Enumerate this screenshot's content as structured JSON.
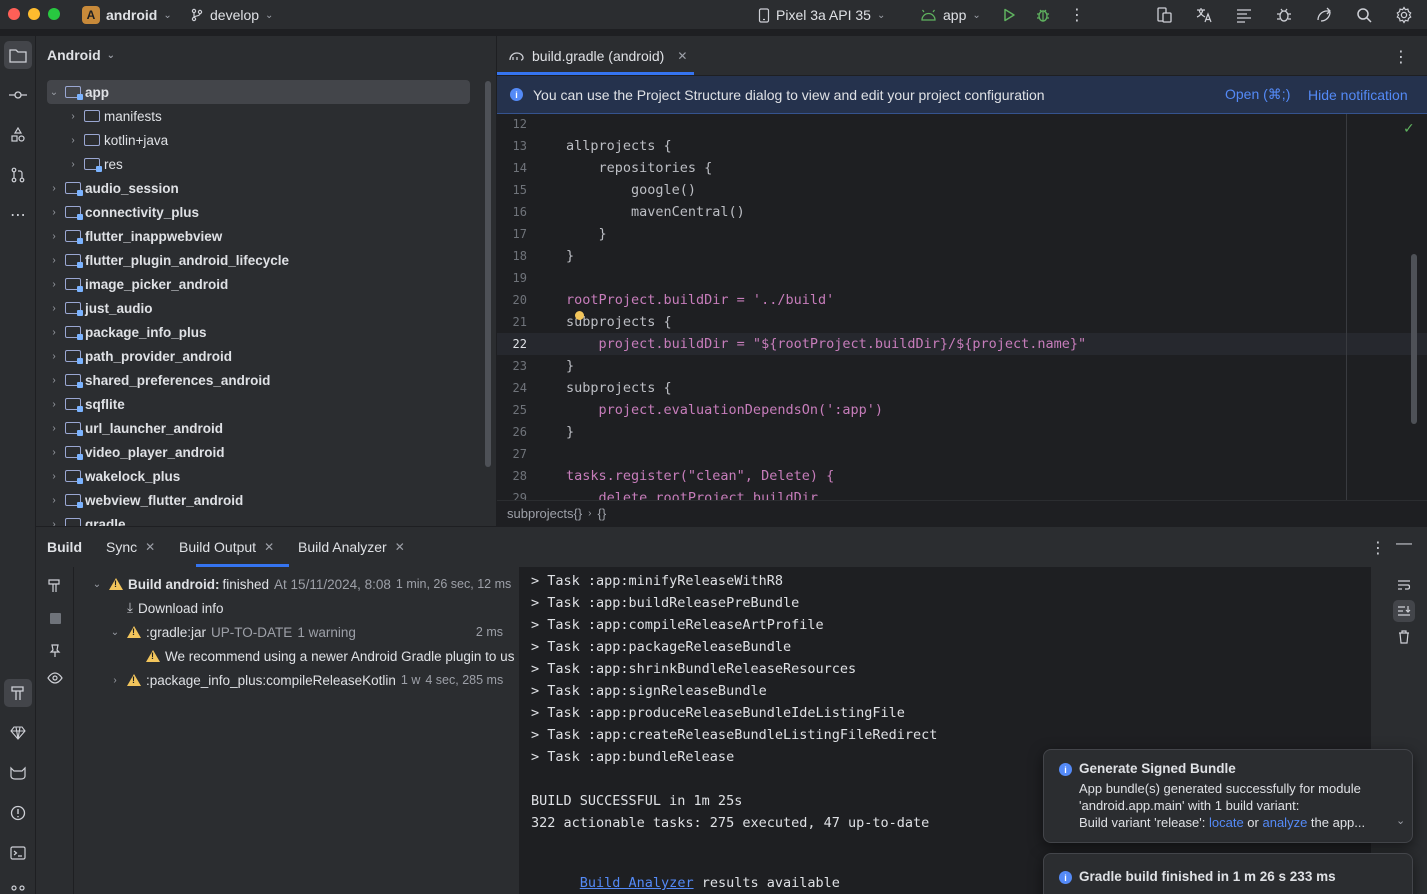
{
  "titlebar": {
    "project_badge": "A",
    "project_name": "android",
    "branch": "develop",
    "device": "Pixel 3a API 35",
    "run_config": "app"
  },
  "project_panel": {
    "title": "Android",
    "items": [
      {
        "label": "app",
        "level": 0,
        "expanded": true,
        "selected": true
      },
      {
        "label": "manifests",
        "level": 1
      },
      {
        "label": "kotlin+java",
        "level": 1
      },
      {
        "label": "res",
        "level": 1
      },
      {
        "label": "audio_session",
        "level": 0
      },
      {
        "label": "connectivity_plus",
        "level": 0
      },
      {
        "label": "flutter_inappwebview",
        "level": 0
      },
      {
        "label": "flutter_plugin_android_lifecycle",
        "level": 0
      },
      {
        "label": "image_picker_android",
        "level": 0
      },
      {
        "label": "just_audio",
        "level": 0
      },
      {
        "label": "package_info_plus",
        "level": 0
      },
      {
        "label": "path_provider_android",
        "level": 0
      },
      {
        "label": "shared_preferences_android",
        "level": 0
      },
      {
        "label": "sqflite",
        "level": 0
      },
      {
        "label": "url_launcher_android",
        "level": 0
      },
      {
        "label": "video_player_android",
        "level": 0
      },
      {
        "label": "wakelock_plus",
        "level": 0
      },
      {
        "label": "webview_flutter_android",
        "level": 0
      },
      {
        "label": "gradle",
        "level": 0
      }
    ]
  },
  "editor": {
    "tab_label": "build.gradle (android)",
    "notification": {
      "text": "You can use the Project Structure dialog to view and edit your project configuration",
      "open_link": "Open (⌘;)",
      "hide_link": "Hide notification"
    },
    "breadcrumb": [
      "subprojects{}",
      "{}"
    ],
    "lines": [
      {
        "n": "12",
        "text": ""
      },
      {
        "n": "13",
        "text": "allprojects {"
      },
      {
        "n": "14",
        "text": "    repositories {"
      },
      {
        "n": "15",
        "text": "        google()"
      },
      {
        "n": "16",
        "text": "        mavenCentral()"
      },
      {
        "n": "17",
        "text": "    }"
      },
      {
        "n": "18",
        "text": "}"
      },
      {
        "n": "19",
        "text": ""
      },
      {
        "n": "20",
        "text": "rootProject.buildDir = '../build'"
      },
      {
        "n": "21",
        "text": "subprojects {"
      },
      {
        "n": "22",
        "text": "    project.buildDir = \"${rootProject.buildDir}/${project.name}\""
      },
      {
        "n": "23",
        "text": "}"
      },
      {
        "n": "24",
        "text": "subprojects {"
      },
      {
        "n": "25",
        "text": "    project.evaluationDependsOn(':app')"
      },
      {
        "n": "26",
        "text": "}"
      },
      {
        "n": "27",
        "text": ""
      },
      {
        "n": "28",
        "text": "tasks.register(\"clean\", Delete) {"
      },
      {
        "n": "29",
        "text": "    delete rootProject.buildDir"
      }
    ]
  },
  "build_panel": {
    "tabs": [
      {
        "label": "Build"
      },
      {
        "label": "Sync"
      },
      {
        "label": "Build Output"
      },
      {
        "label": "Build Analyzer"
      }
    ],
    "tree": {
      "root_label": "Build android:",
      "root_status": "finished",
      "root_time": "At 15/11/2024, 8:08",
      "root_duration": "1 min, 26 sec, 12 ms",
      "download_info": "Download info",
      "gradle_jar": ":gradle:jar",
      "gradle_jar_status": "UP-TO-DATE",
      "gradle_jar_warn": "1 warning",
      "gradle_jar_time": "2 ms",
      "warning_msg": "We recommend using a newer Android Gradle plugin to us",
      "compile_task": ":package_info_plus:compileReleaseKotlin",
      "compile_warn": "1 w",
      "compile_time": "4 sec, 285 ms"
    },
    "console": [
      "> Task :app:minifyReleaseWithR8",
      "> Task :app:buildReleasePreBundle",
      "> Task :app:compileReleaseArtProfile",
      "> Task :app:packageReleaseBundle",
      "> Task :app:shrinkBundleReleaseResources",
      "> Task :app:signReleaseBundle",
      "> Task :app:produceReleaseBundleIdeListingFile",
      "> Task :app:createReleaseBundleListingFileRedirect",
      "> Task :app:bundleRelease",
      "",
      "BUILD SUCCESSFUL in 1m 25s",
      "322 actionable tasks: 275 executed, 47 up-to-date"
    ],
    "analyzer_link": "Build Analyzer",
    "analyzer_suffix": " results available"
  },
  "toasts": {
    "signed": {
      "title": "Generate Signed Bundle",
      "line1": "App bundle(s) generated successfully for module",
      "line2": "'android.app.main' with 1 build variant:",
      "line3_prefix": "Build variant 'release': ",
      "locate": "locate",
      "or": " or ",
      "analyze": "analyze",
      "line3_suffix": " the app..."
    },
    "gradle": {
      "title": "Gradle build finished in 1 m 26 s 233 ms"
    }
  }
}
